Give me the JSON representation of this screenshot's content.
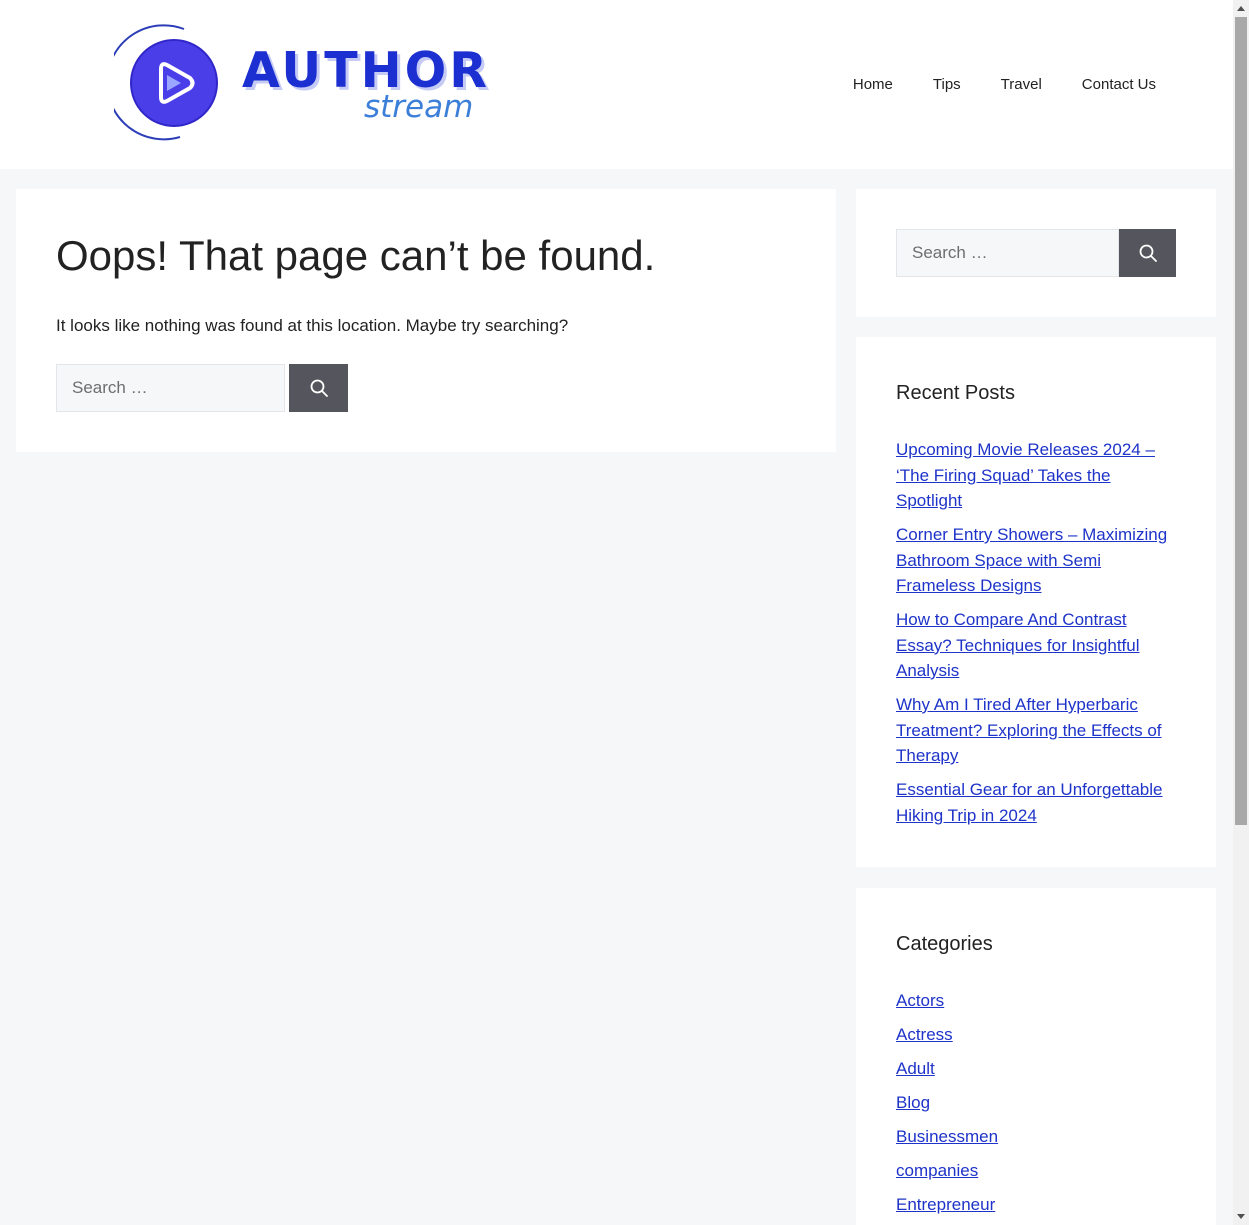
{
  "logo": {
    "word": "AUTHOR",
    "sub": "stream",
    "colors": {
      "primary": "#1c2fd1",
      "accent": "#3c7fd8",
      "mark": "#4a3ee8"
    }
  },
  "nav": {
    "items": [
      {
        "label": "Home"
      },
      {
        "label": "Tips"
      },
      {
        "label": "Travel"
      },
      {
        "label": "Contact Us"
      }
    ]
  },
  "main": {
    "title": "Oops! That page can’t be found.",
    "text": "It looks like nothing was found at this location. Maybe try searching?",
    "search": {
      "placeholder": "Search …"
    }
  },
  "sidebar": {
    "search": {
      "placeholder": "Search …"
    },
    "recent_posts": {
      "title": "Recent Posts",
      "items": [
        {
          "label": "Upcoming Movie Releases 2024 – ‘The Firing Squad’ Takes the Spotlight"
        },
        {
          "label": "Corner Entry Showers – Maximizing Bathroom Space with Semi Frameless Designs"
        },
        {
          "label": "How to Compare And Contrast Essay? Techniques for Insightful Analysis"
        },
        {
          "label": "Why Am I Tired After Hyperbaric Treatment? Exploring the Effects of Therapy"
        },
        {
          "label": "Essential Gear for an Unforgettable Hiking Trip in 2024"
        }
      ]
    },
    "categories": {
      "title": "Categories",
      "items": [
        {
          "label": "Actors"
        },
        {
          "label": "Actress"
        },
        {
          "label": "Adult"
        },
        {
          "label": "Blog"
        },
        {
          "label": "Businessmen"
        },
        {
          "label": "companies"
        },
        {
          "label": "Entrepreneur"
        }
      ]
    }
  },
  "theme": {
    "link_color": "#1e33c9",
    "button_color": "#55555e",
    "background": "#f6f7f9"
  }
}
